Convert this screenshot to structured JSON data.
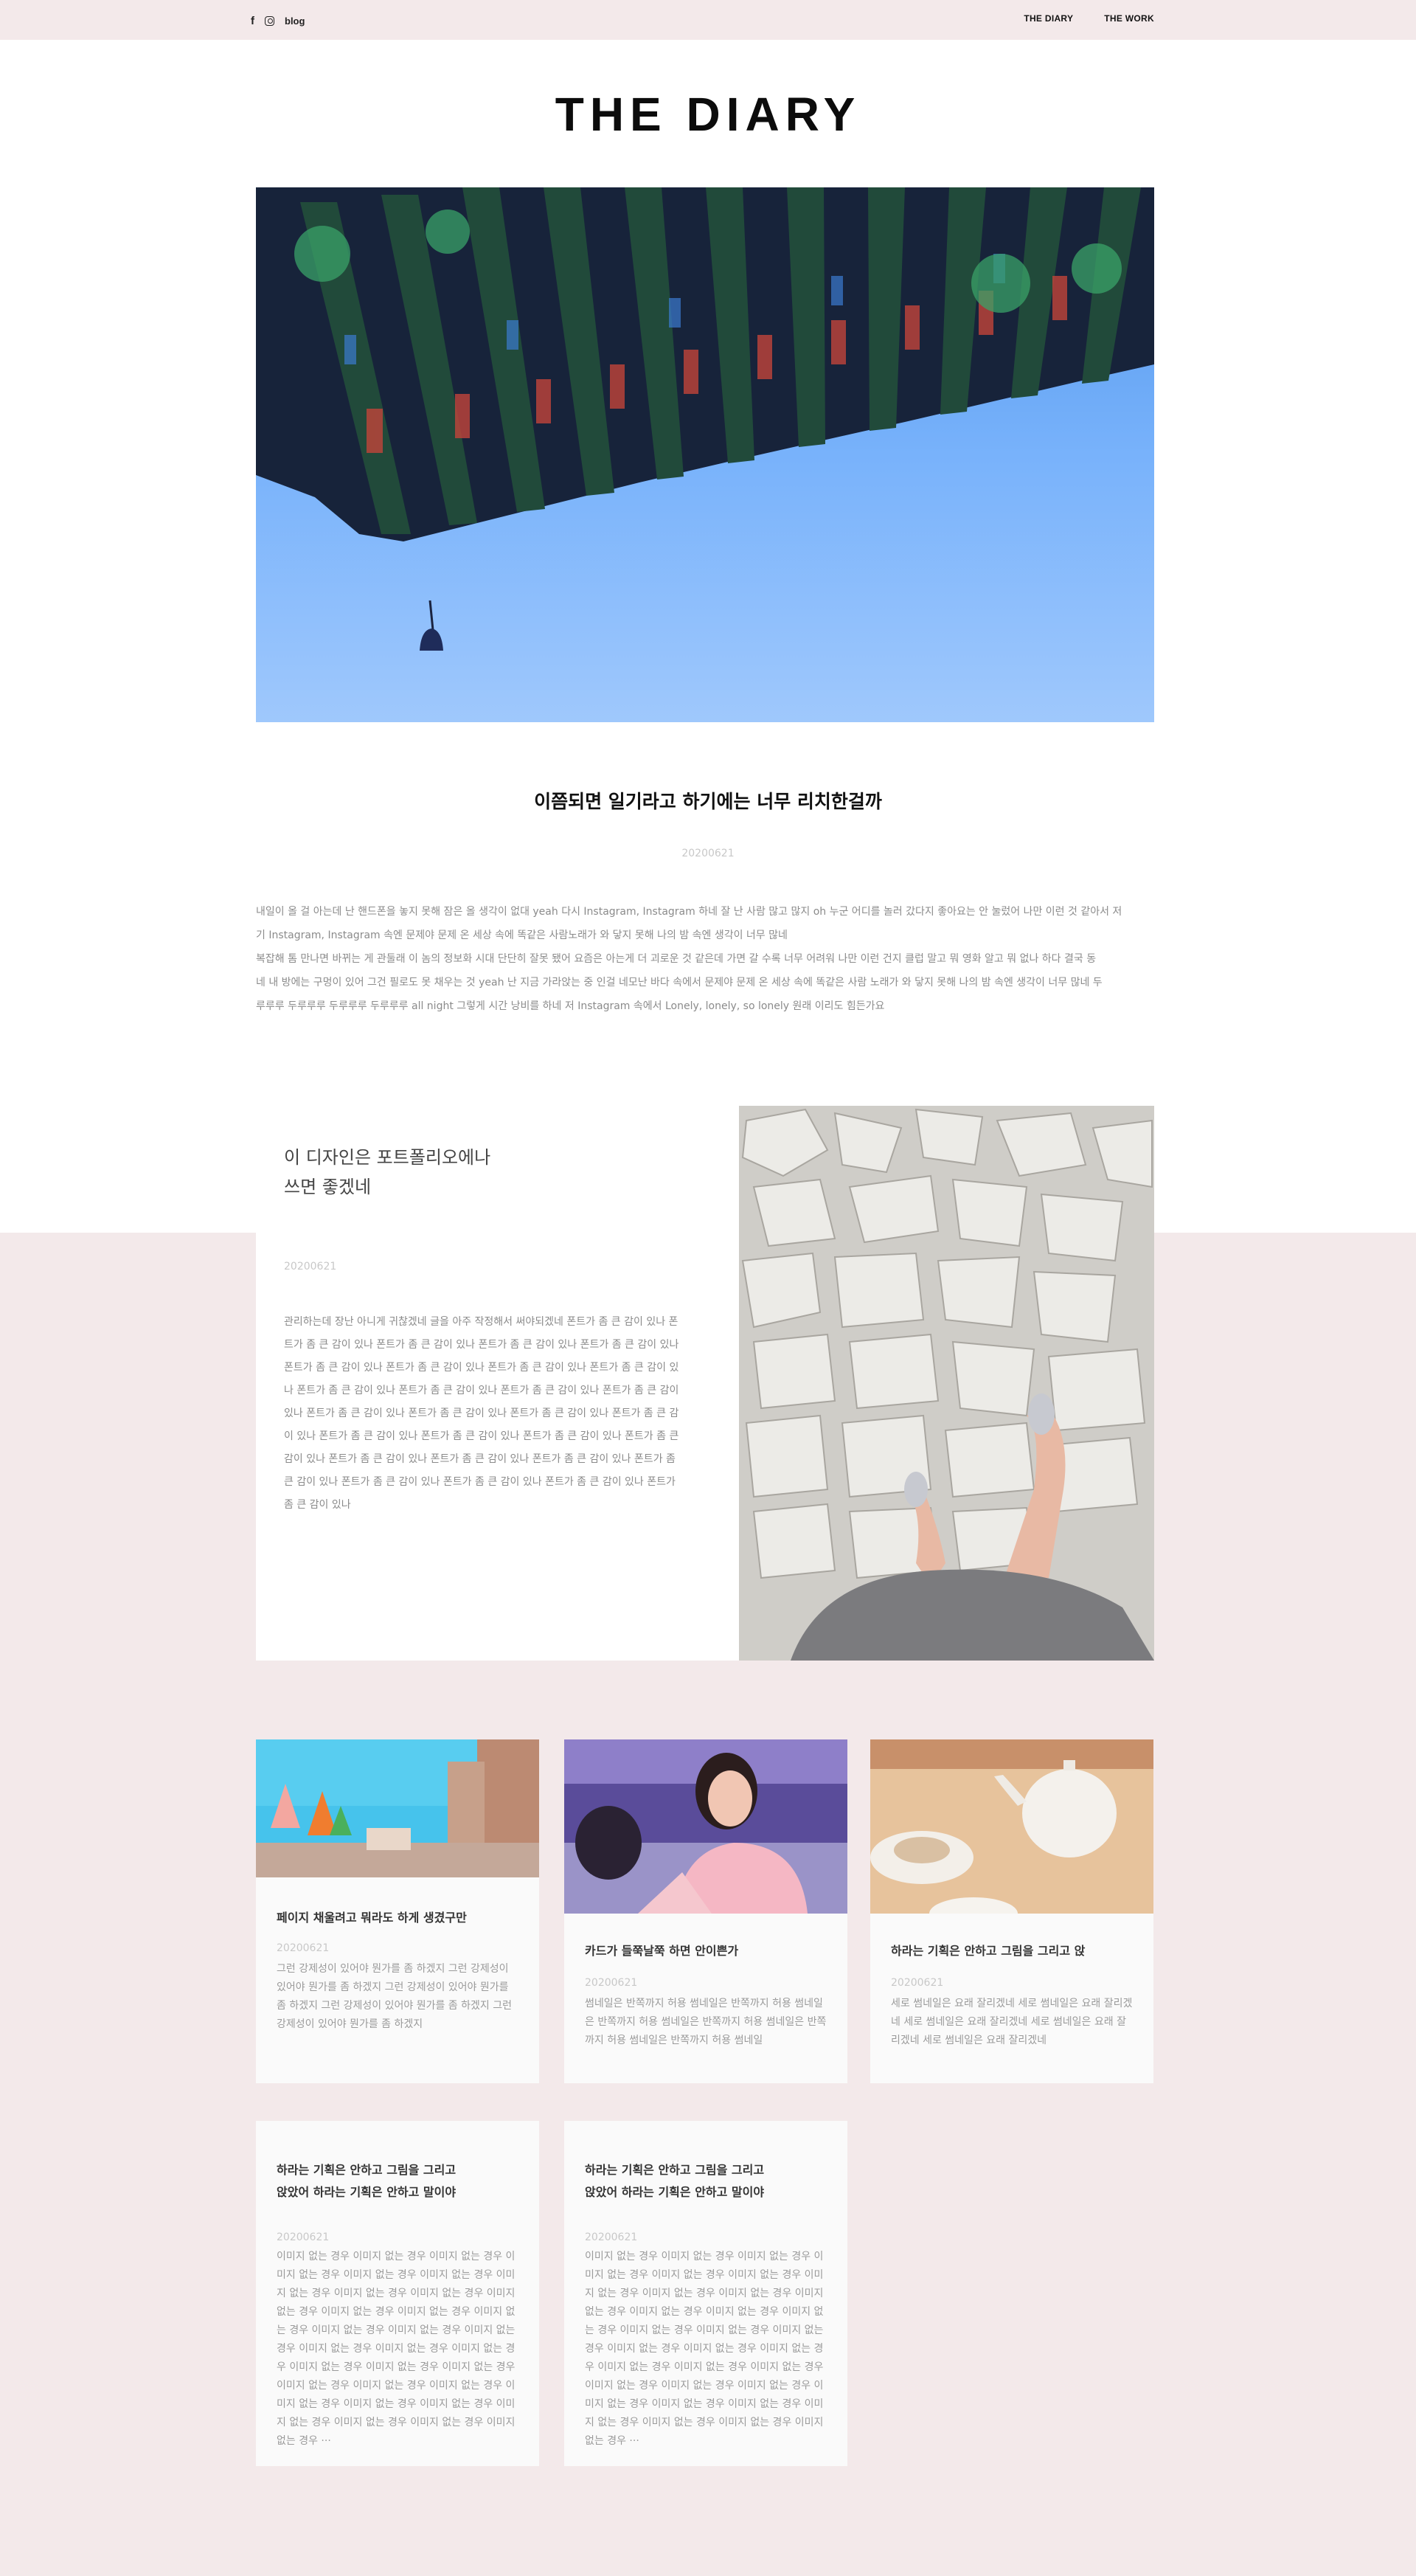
{
  "nav": {
    "facebook_icon_glyph": "f",
    "instagram_icon": "instagram-icon",
    "blog_label": "blog",
    "links": [
      "THE DIARY",
      "THE WORK"
    ]
  },
  "site": {
    "title": "THE DIARY"
  },
  "hero_post": {
    "title": "이쯤되면 일기라고 하기에는 너무 리치한걸까",
    "date": "20200621",
    "body_lines": [
      "내일이 올 걸 아는데 난 핸드폰을 놓지 못해 잠은 올 생각이 없대 yeah 다시 Instagram, Instagram 하네 잘 난 사람 많고 많지 oh 누군 어디를 놀러 갔다지 좋아요는 안 눌렀어 나만 이런 것 같아서 저",
      "기 Instagram, Instagram 속엔 문제야 문제 온 세상 속에 똑같은 사람노래가 와 닿지 못해 나의 밤 속엔 생각이 너무 많네",
      "복잡해 톰 만나면 바뀌는 게 관둘래 이 놈의 정보화 시대 단단히 잘못 됐어 요즘은 아는게 더 괴로운 것 같은데 가면 갈 수록 너무 어려워 나만 이런 건지 클럽 말고 뭐 영화 알고 뭐 없나 하다 결국 동",
      "네 내 방에는 구멍이 있어 그건 필로도 못 채우는 것 yeah 난 지금 가라앉는 중 인걸 네모난 바다 속에서 문제야 문제 온 세상 속에 똑같은 사람 노래가 와 닿지 못해 나의 밤 속엔 생각이 너무 많네 두",
      "루루루 두루루루 두루루루 두루루루 all night 그렇게 시간 낭비를 하네 저 Instagram 속에서 Lonely, lonely, so lonely 원래 이리도 힘든가요"
    ]
  },
  "featured_post": {
    "title": "이 디자인은 포트폴리오에나 쓰면 좋겠네",
    "date": "20200621",
    "excerpt": "관리하는데 장난 아니게 귀찮겠네 글을 아주 작정해서 써야되겠네 폰트가 좀 큰 감이 있나 폰트가 좀 큰 감이 있나 폰트가 좀 큰 감이 있나 폰트가 좀 큰 감이 있나 폰트가 좀 큰 감이 있나 폰트가 좀 큰 감이 있나 폰트가 좀 큰 감이 있나 폰트가 좀 큰 감이 있나 폰트가 좀 큰 감이 있나 폰트가 좀 큰 감이 있나 폰트가 좀 큰 감이 있나 폰트가 좀 큰 감이 있나 폰트가 좀 큰 감이 있나 폰트가 좀 큰 감이 있나 폰트가 좀 큰 감이 있나 폰트가 좀 큰 감이 있나 폰트가 좀 큰 감이 있나 폰트가 좀 큰 감이 있나 폰트가 좀 큰 감이 있나 폰트가 좀 큰 감이 있나 폰트가 좀 큰 감이 있나 폰트가 좀 큰 감이 있나 폰트가 좀 큰 감이 있나 폰트가 좀 큰 감이 있나 폰트가 좀 큰 감이 있나 폰트가 좀 큰 감이 있나 폰트가 좀 큰 감이 있나 폰트가 좀 큰 감이 있나 폰트가 좀 큰 감이 있나"
  },
  "cards": [
    {
      "title": "페이지 채울려고 뭐라도 하게 생겼구만",
      "date": "20200621",
      "excerpt": "그런 강제성이 있어야 뭔가를 좀 하겠지 그런 강제성이 있어야 뭔가를 좀 하겠지 그런 강제성이 있어야 뭔가를 좀 하겠지 그런 강제성이 있어야 뭔가를 좀 하겠지 그런 강제성이 있어야 뭔가를 좀 하겠지"
    },
    {
      "title": "카드가 들쭉날쭉 하면 안이쁜가",
      "date": "20200621",
      "excerpt": "썸네일은 반쪽까지 허용 썸네일은 반쪽까지 허용 썸네일은 반쪽까지 허용 썸네일은 반쪽까지 허용 썸네일은 반쪽까지 허용 썸네일은 반쪽까지 허용 썸네일"
    },
    {
      "title": "하라는 기획은 안하고 그림을 그리고 앉",
      "date": "20200621",
      "excerpt": "세로 썸네일은 요래 잘리겠네 세로 썸네일은 요래 잘리겠네 세로 썸네일은 요래 잘리겠네 세로 썸네일은 요래 잘리겠네 세로 썸네일은 요래 잘리겠네"
    },
    {
      "title": "하라는 기획은 안하고 그림을 그리고 앉았어 하라는 기획은 안하고 말이야",
      "date": "20200621",
      "excerpt": "이미지 없는 경우 이미지 없는 경우 이미지 없는 경우 이미지 없는 경우 이미지 없는 경우 이미지 없는 경우 이미지 없는 경우 이미지 없는 경우 이미지 없는 경우 이미지 없는 경우 이미지 없는 경우 이미지 없는 경우 이미지 없는 경우 이미지 없는 경우 이미지 없는 경우 이미지 없는 경우 이미지 없는 경우 이미지 없는 경우 이미지 없는 경우 이미지 없는 경우 이미지 없는 경우 이미지 없는 경우 이미지 없는 경우 이미지 없는 경우 이미지 없는 경우 이미지 없는 경우 이미지 없는 경우 이미지 없는 경우 이미지 없는 경우 이미지 없는 경우 이미지 없는 경우 이미지 없는 경우 ···"
    },
    {
      "title": "하라는 기획은 안하고 그림을 그리고 앉았어 하라는 기획은 안하고 말이야",
      "date": "20200621",
      "excerpt": "이미지 없는 경우 이미지 없는 경우 이미지 없는 경우 이미지 없는 경우 이미지 없는 경우 이미지 없는 경우 이미지 없는 경우 이미지 없는 경우 이미지 없는 경우 이미지 없는 경우 이미지 없는 경우 이미지 없는 경우 이미지 없는 경우 이미지 없는 경우 이미지 없는 경우 이미지 없는 경우 이미지 없는 경우 이미지 없는 경우 이미지 없는 경우 이미지 없는 경우 이미지 없는 경우 이미지 없는 경우 이미지 없는 경우 이미지 없는 경우 이미지 없는 경우 이미지 없는 경우 이미지 없는 경우 이미지 없는 경우 이미지 없는 경우 이미지 없는 경우 이미지 없는 경우 이미지 없는 경우 ···"
    }
  ],
  "colors": {
    "page_background": "#f3e9ea",
    "white_region": "#ffffff",
    "card_background": "#fafafa",
    "date_text": "#c8c8c8",
    "body_text": "#8b8b8b"
  }
}
